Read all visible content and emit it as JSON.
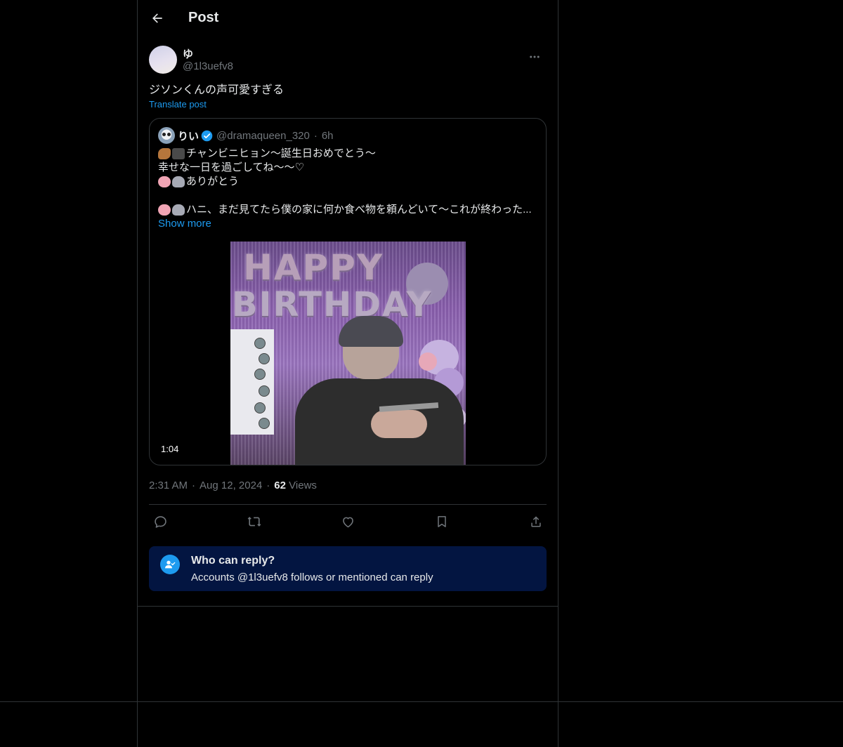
{
  "header": {
    "title": "Post",
    "back_icon": "arrow-left-icon"
  },
  "post": {
    "author": {
      "name": "ゆ",
      "handle": "@1l3uefv8"
    },
    "text": "ジソンくんの声可愛すぎる",
    "translate_label": "Translate post",
    "more_icon": "more-horizontal-icon"
  },
  "quote": {
    "name": "りい",
    "handle": "@dramaqueen_320",
    "separator": "·",
    "time": "6h",
    "lines": [
      "チャンビニヒョン〜誕生日おめでとう〜",
      "幸せな一日を過ごしてね〜〜♡",
      "ありがとう",
      "",
      "ハニ、まだ見てたら僕の家に何か食べ物を頼んどいて〜これが終わった..."
    ],
    "show_more": "Show more",
    "video": {
      "duration": "1:04",
      "balloon_line1": "HAPPY",
      "balloon_line2": "BIRTHDAY"
    }
  },
  "meta": {
    "time": "2:31 AM",
    "date": "Aug 12, 2024",
    "separator": "·",
    "views_count": "62",
    "views_label": "Views"
  },
  "actions": [
    "reply-icon",
    "repost-icon",
    "like-icon",
    "bookmark-icon",
    "share-icon"
  ],
  "who_can_reply": {
    "title": "Who can reply?",
    "subtitle": "Accounts @1l3uefv8 follows or mentioned can reply"
  },
  "colors": {
    "background": "#000000",
    "divider": "#2f3336",
    "accent": "#1d9bf0",
    "secondary_text": "#71767b",
    "card": "#031541"
  }
}
